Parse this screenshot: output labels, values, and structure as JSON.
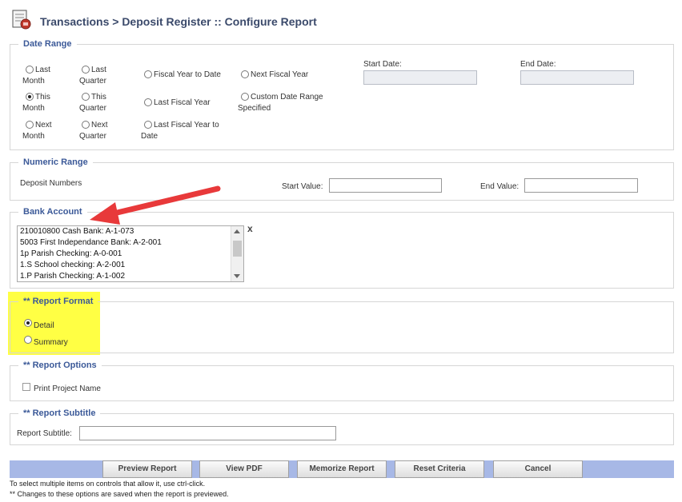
{
  "header": {
    "title": "Transactions > Deposit Register :: Configure Report",
    "icon": "report-icon"
  },
  "date_range": {
    "legend": "Date Range",
    "options": [
      {
        "label_1": "Last",
        "label_2": "Month",
        "selected": false
      },
      {
        "label_1": "Last",
        "label_2": "Quarter",
        "selected": false
      },
      {
        "label_1": "Fiscal Year to Date",
        "selected": false
      },
      {
        "label_1": "Next Fiscal Year",
        "selected": false
      },
      {
        "label_1": "This",
        "label_2": "Month",
        "selected": true
      },
      {
        "label_1": "This",
        "label_2": "Quarter",
        "selected": false
      },
      {
        "label_1": "Last Fiscal Year",
        "selected": false
      },
      {
        "label_1": "Custom Date Range",
        "label_2": "Specified",
        "selected": false
      },
      {
        "label_1": "Next",
        "label_2": "Month",
        "selected": false
      },
      {
        "label_1": "Next",
        "label_2": "Quarter",
        "selected": false
      },
      {
        "label_1": "Last Fiscal Year to",
        "label_2": "Date",
        "selected": false
      }
    ],
    "start_date_label": "Start Date:",
    "end_date_label": "End Date:",
    "start_date_value": "",
    "end_date_value": ""
  },
  "numeric_range": {
    "legend": "Numeric Range",
    "field_label": "Deposit Numbers",
    "start_label": "Start Value:",
    "end_label": "End Value:",
    "start_value": "",
    "end_value": ""
  },
  "bank_account": {
    "legend": "Bank Account",
    "clear_label": "x",
    "items": [
      "210010800 Cash Bank: A-1-073",
      "5003 First Independance Bank: A-2-001",
      "1p Parish Checking: A-0-001",
      "1.S School checking: A-2-001",
      "1.P Parish Checking: A-1-002"
    ]
  },
  "report_format": {
    "legend": "** Report Format",
    "options": [
      {
        "label": "Detail",
        "selected": true
      },
      {
        "label": "Summary",
        "selected": false
      }
    ],
    "highlight_color": "#ffff44"
  },
  "report_options": {
    "legend": "** Report Options",
    "print_project_name_label": "Print Project Name",
    "print_project_name_checked": false
  },
  "report_subtitle": {
    "legend": "** Report Subtitle",
    "field_label": "Report Subtitle:",
    "value": ""
  },
  "buttons": {
    "preview": "Preview Report",
    "view_pdf": "View PDF",
    "memorize": "Memorize Report",
    "reset": "Reset Criteria",
    "cancel": "Cancel"
  },
  "notes": {
    "line1": "To select multiple items on controls that allow it, use ctrl-click.",
    "line2": "** Changes to these options are saved when the report is previewed."
  },
  "annotation": {
    "arrow_color": "#e8393a"
  }
}
